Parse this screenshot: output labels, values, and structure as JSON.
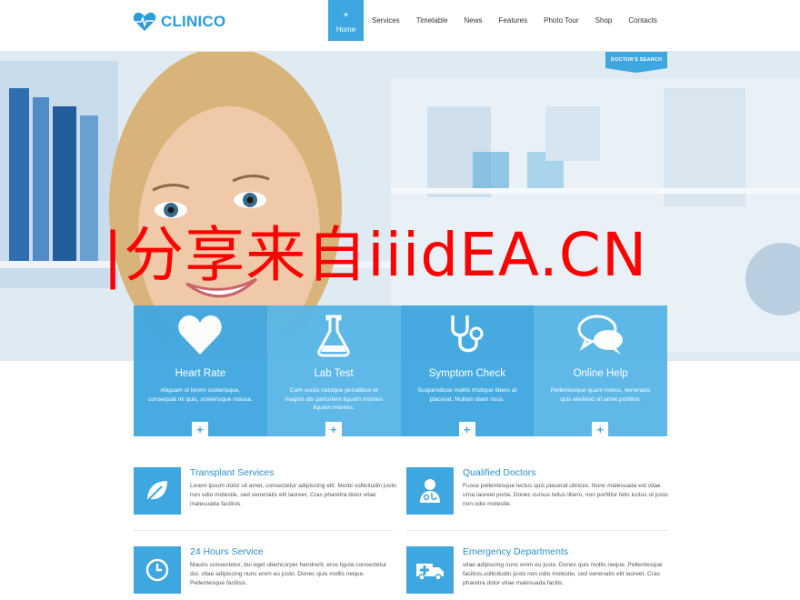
{
  "brand": {
    "name": "CLINICO"
  },
  "nav": {
    "items": [
      {
        "label": "Home",
        "active": true
      },
      {
        "label": "Services"
      },
      {
        "label": "Timetable"
      },
      {
        "label": "News"
      },
      {
        "label": "Features"
      },
      {
        "label": "Photo Tour"
      },
      {
        "label": "Shop"
      },
      {
        "label": "Contacts"
      }
    ],
    "active_plus": "+"
  },
  "hero": {
    "doctor_search": "DOCTOR'S SEARCH"
  },
  "features": [
    {
      "icon": "heart-icon",
      "title": "Heart Rate",
      "desc": "Aliquam ut lorem scelerisque, consequat mi quis, scelerisque massa.",
      "color": "#3ea7e0"
    },
    {
      "icon": "flask-icon",
      "title": "Lab Test",
      "desc": "Cum sociis natoque penatibus et magnis dis parturient liquam montes liquam montes.",
      "color": "#57b5e7"
    },
    {
      "icon": "stethoscope-icon",
      "title": "Symptom Check",
      "desc": "Suspendisse mattis tristique libero at placerat. Nullam diam risus.",
      "color": "#3ea7e0"
    },
    {
      "icon": "chat-icon",
      "title": "Online Help",
      "desc": "Pellentesque quam metus, venenatis quis eleifend sit amet porttitor.",
      "color": "#57b5e7"
    }
  ],
  "feature_more": "+",
  "services": [
    {
      "icon": "leaf-icon",
      "title": "Transplant Services",
      "text": "Lorem ipsum dolor sit amet, consectetur adipiscing elit. Morbi sollicitudin justo non odio molestie, sed venenatis elit laoreet. Cras pharetra dolor vitae malesuada facilisis."
    },
    {
      "icon": "doctor-icon",
      "title": "Qualified Doctors",
      "text": "Fusce pellentesque lectus quis placerat ultrices. Nunc malesuada est vitae urna laoreet porta. Donec cursus tellus libero, non porttitor felis luctus ut justo non odio molestie."
    },
    {
      "icon": "clock-icon",
      "title": "24 Hours Service",
      "text": "Mauris consectetur, dui eget ullamcorper hendrerit, eros ligula consectetur dui, vitae adipiscing nunc enim eu justo. Donec quis mollis neque. Pellentesque facilisis."
    },
    {
      "icon": "ambulance-icon",
      "title": "Emergency Departments",
      "text": "vitae adipiscing nunc enim eu justo. Donec quis mollis neque. Pellentesque facilisis,sollicitudin justo non odio molestie, sed venenatis elit laoreet. Cras pharetra dolor vitae malesuada facilis."
    }
  ],
  "watermark": "|分享来自iiidEA.CN",
  "colors": {
    "accent": "#3ea7e0",
    "accent_light": "#57b5e7",
    "title_blue": "#2b8fce",
    "watermark": "#ff0000"
  }
}
